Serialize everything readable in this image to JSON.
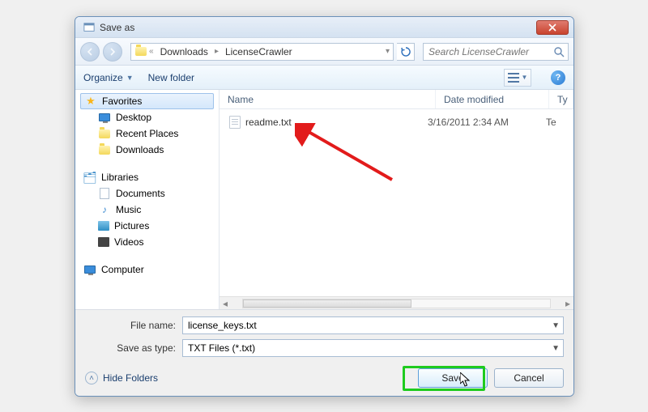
{
  "window": {
    "title": "Save as"
  },
  "nav": {
    "breadcrumb": [
      "Downloads",
      "LicenseCrawler"
    ],
    "search_placeholder": "Search LicenseCrawler"
  },
  "toolbar": {
    "organize": "Organize",
    "new_folder": "New folder"
  },
  "sidebar": {
    "favorites": {
      "label": "Favorites",
      "items": [
        {
          "label": "Desktop",
          "icon": "monitor-icon"
        },
        {
          "label": "Recent Places",
          "icon": "folder-icon"
        },
        {
          "label": "Downloads",
          "icon": "folder-icon"
        }
      ]
    },
    "libraries": {
      "label": "Libraries",
      "items": [
        {
          "label": "Documents",
          "icon": "documents-icon"
        },
        {
          "label": "Music",
          "icon": "music-icon"
        },
        {
          "label": "Pictures",
          "icon": "pictures-icon"
        },
        {
          "label": "Videos",
          "icon": "videos-icon"
        }
      ]
    },
    "computer": {
      "label": "Computer"
    }
  },
  "columns": {
    "name": "Name",
    "date": "Date modified",
    "type": "Ty"
  },
  "files": [
    {
      "name": "readme.txt",
      "date": "3/16/2011 2:34 AM",
      "type": "Te"
    }
  ],
  "form": {
    "filename_label": "File name:",
    "filename_value": "license_keys.txt",
    "savetype_label": "Save as type:",
    "savetype_value": "TXT Files (*.txt)"
  },
  "actions": {
    "hide_folders": "Hide Folders",
    "save": "Save",
    "cancel": "Cancel"
  }
}
